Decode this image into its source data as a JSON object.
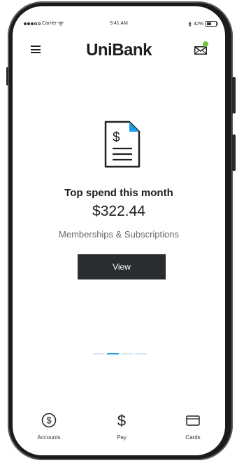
{
  "status_bar": {
    "carrier": "Carrier",
    "time": "9:41 AM",
    "battery": "42%"
  },
  "header": {
    "app_name": "UniBank"
  },
  "main": {
    "title": "Top spend this month",
    "amount": "$322.44",
    "category": "Memberships & Subscriptions",
    "view_label": "View"
  },
  "pager": {
    "pages": 4,
    "active_index": 1
  },
  "tab_bar": {
    "items": [
      {
        "label": "Accounts",
        "icon": "dollar-circle-icon"
      },
      {
        "label": "Pay",
        "icon": "dollar-icon"
      },
      {
        "label": "Cards",
        "icon": "card-icon"
      }
    ]
  },
  "colors": {
    "accent": "#1b9be8",
    "notification": "#71c540",
    "button": "#2a2d30"
  }
}
